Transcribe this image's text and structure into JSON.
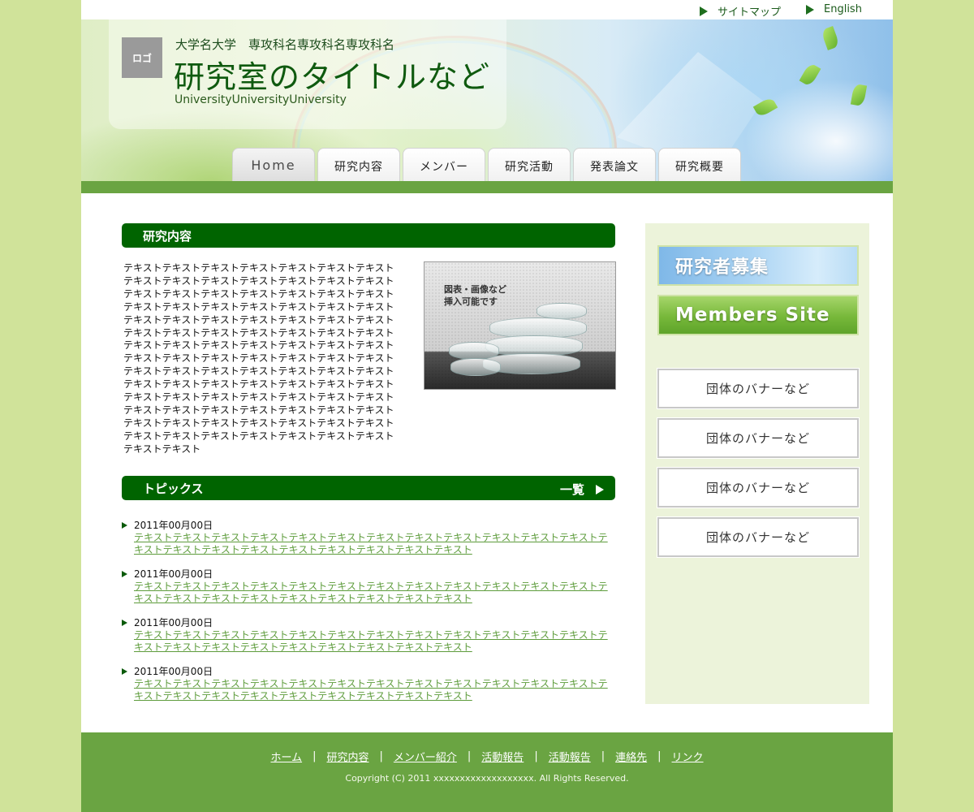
{
  "top_links": {
    "sitemap": "サイトマップ",
    "english": "English"
  },
  "header": {
    "logo": "ロゴ",
    "university_line": "大学名大学　専攻科名専攻科名専攻科名",
    "title": "研究室のタイトルなど",
    "subtitle": "UniversityUniversityUniversity"
  },
  "nav": {
    "tabs": [
      "Home",
      "研究内容",
      "メンバー",
      "研究活動",
      "発表論文",
      "研究概要"
    ],
    "active_index": 0
  },
  "research": {
    "heading": "研究内容",
    "text": "テキストテキストテキストテキストテキストテキストテキストテキストテキストテキストテキストテキストテキストテキストテキストテキストテキストテキストテキストテキストテキストテキストテキストテキストテキストテキストテキストテキストテキストテキストテキストテキストテキストテキストテキストテキストテキストテキストテキストテキストテキストテキストテキストテキストテキストテキストテキストテキストテキストテキストテキストテキストテキストテキストテキストテキストテキストテキストテキストテキストテキストテキストテキストテキストテキストテキストテキストテキストテキストテキストテキストテキストテキストテキストテキストテキストテキストテキストテキストテキストテキストテキストテキストテキストテキストテキストテキストテキストテキストテキストテキストテキストテキストテキストテキストテキストテキストテキストテキストテキスト",
    "figure_caption": "図表・画像など\n挿入可能です"
  },
  "topics": {
    "heading": "トピックス",
    "more_label": "一覧",
    "items": [
      {
        "date": "2011年00月00日",
        "text": "テキストテキストテキストテキストテキストテキストテキストテキストテキストテキストテキストテキストテキストテキストテキストテキストテキストテキストテキストテキストテキスト"
      },
      {
        "date": "2011年00月00日",
        "text": "テキストテキストテキストテキストテキストテキストテキストテキストテキストテキストテキストテキストテキストテキストテキストテキストテキストテキストテキストテキストテキスト"
      },
      {
        "date": "2011年00月00日",
        "text": "テキストテキストテキストテキストテキストテキストテキストテキストテキストテキストテキストテキストテキストテキストテキストテキストテキストテキストテキストテキストテキスト"
      },
      {
        "date": "2011年00月00日",
        "text": "テキストテキストテキストテキストテキストテキストテキストテキストテキストテキストテキストテキストテキストテキストテキストテキストテキストテキストテキストテキストテキスト"
      }
    ]
  },
  "sidebar": {
    "recruit_banner": "研究者募集",
    "members_banner": "Members Site",
    "org_banners": [
      "団体のバナーなど",
      "団体のバナーなど",
      "団体のバナーなど",
      "団体のバナーなど"
    ]
  },
  "footer": {
    "links": [
      "ホーム",
      "研究内容",
      "メンバー紹介",
      "活動報告",
      "活動報告",
      "連絡先",
      "リンク"
    ],
    "separator": "|",
    "copyright": "Copyright (C) 2011 xxxxxxxxxxxxxxxxxxx. All Rights Reserved."
  },
  "colors": {
    "page_background": "#d0e39a",
    "dark_green": "#006400",
    "accent_green": "#6aa442",
    "link_green": "#5e9c3c",
    "sidebar_background": "#ecf3da"
  }
}
